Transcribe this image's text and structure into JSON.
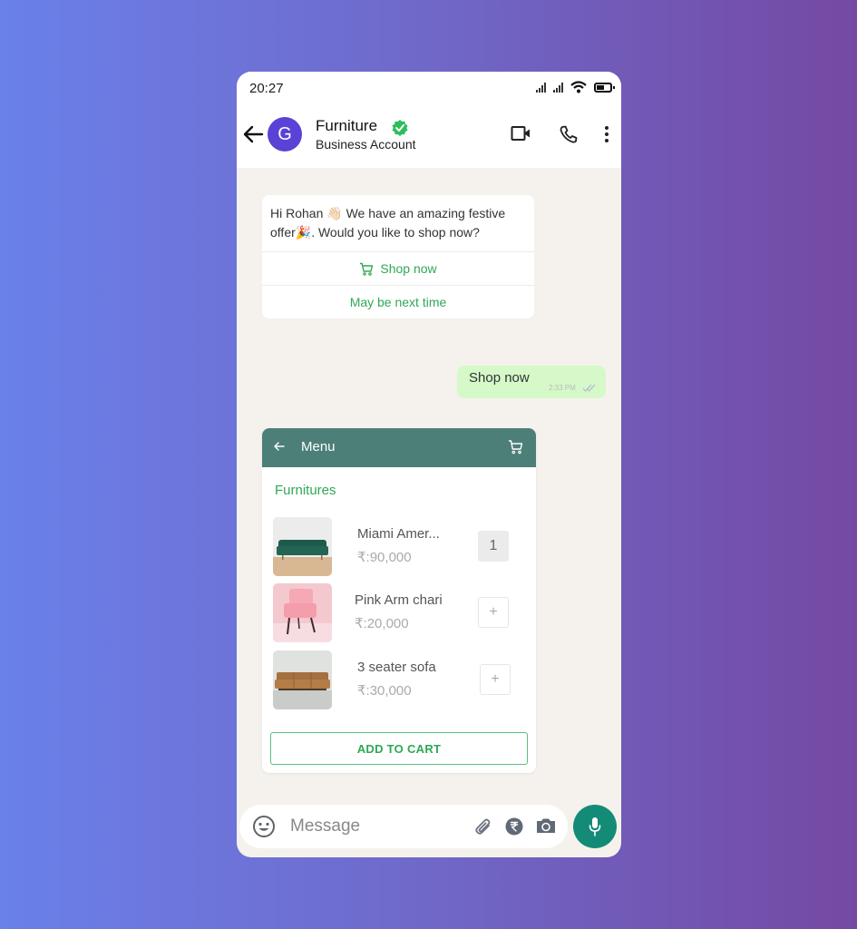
{
  "status_bar": {
    "time": "20:27",
    "icons": [
      "signal-icon",
      "signal-icon",
      "wifi-icon",
      "battery-icon"
    ]
  },
  "header": {
    "avatar_letter": "G",
    "contact_name": "Furniture",
    "verified": true,
    "subtitle": "Business Account",
    "actions": [
      "video-call-icon",
      "voice-call-icon",
      "more-options-icon"
    ]
  },
  "colors": {
    "accent_green": "#2fa855",
    "menu_header": "#4c7f77",
    "avatar": "#5a42d6",
    "mic_button": "#148b77",
    "outgoing_bubble": "#d5f9c9",
    "chat_background": "#f5f2ed"
  },
  "messages": {
    "incoming": {
      "text": "Hi Rohan 👋🏻 We have an amazing festive offer🎉. Would you like to shop now?",
      "quick_replies": [
        {
          "label": "Shop now",
          "icon": "cart-icon"
        },
        {
          "label": "May be next time"
        }
      ]
    },
    "outgoing": {
      "text": "Shop now",
      "time": "2:33 PM",
      "status": "read"
    }
  },
  "menu": {
    "title": "Menu",
    "category": "Furnitures",
    "items": [
      {
        "name": "Miami Amer...",
        "price": "₹:90,000",
        "quantity": "1"
      },
      {
        "name": "Pink Arm chari",
        "price": "₹:20,000",
        "quantity": "+"
      },
      {
        "name": "3 seater sofa",
        "price": "₹:30,000",
        "quantity": "+"
      }
    ],
    "add_to_cart_label": "ADD TO CART"
  },
  "composer": {
    "placeholder": "Message",
    "value": ""
  }
}
